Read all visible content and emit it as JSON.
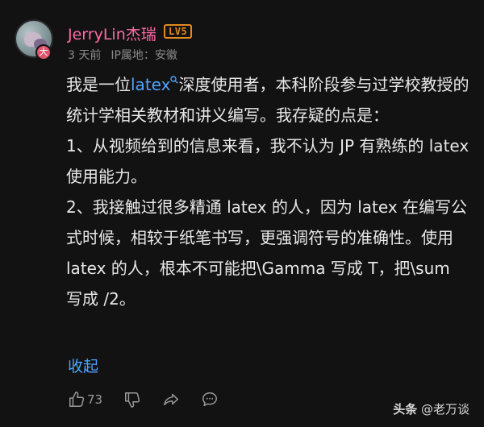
{
  "user": {
    "name": "JerryLin杰瑞",
    "level": "LV5",
    "avatar_badge": "大",
    "time": "3 天前",
    "location_label": "IP属地：安徽",
    "name_color": "#ff6aa6",
    "level_color": "#e58a1f"
  },
  "comment": {
    "p1_before": "我是一位",
    "keyword": "latex",
    "keyword_icon": "search-icon",
    "p1_after": "深度使用者，本科阶段参与过学校教授的统计学相关教材和讲义编写。我存疑的点是：",
    "p2": "1、从视频给到的信息来看，我不认为 JP 有熟练的 latex 使用能力。",
    "p3": "2、我接触过很多精通 latex 的人，因为 latex 在编写公式时候，相较于纸笔书写，更强调符号的准确性。使用 latex 的人，根本不可能把\\Gamma 写成 T，把\\sum 写成 /2。",
    "link_color": "#4fa3ff"
  },
  "collapse_label": "收起",
  "actions": {
    "like_count": "73",
    "like_icon": "thumbs-up-icon",
    "dislike_icon": "thumbs-down-icon",
    "share_icon": "share-arrow-icon",
    "comment_icon": "comment-bubble-icon"
  },
  "watermark": {
    "brand": "头条",
    "handle": "@老万谈"
  }
}
